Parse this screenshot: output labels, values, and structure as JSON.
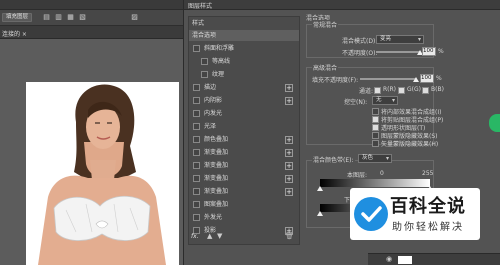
{
  "app": {
    "tab_title": "填充图层",
    "doc_tab": "连接的 ×"
  },
  "dialog": {
    "title": "图层样式",
    "styles_header": "样式",
    "blend_options_item": "混合选项",
    "styles": [
      {
        "label": "斜面和浮雕",
        "checkbox": true,
        "plus": false,
        "indent": 1
      },
      {
        "label": "等高线",
        "checkbox": true,
        "plus": false,
        "indent": 2
      },
      {
        "label": "纹理",
        "checkbox": true,
        "plus": false,
        "indent": 2
      },
      {
        "label": "描边",
        "checkbox": true,
        "plus": true,
        "indent": 1
      },
      {
        "label": "内阴影",
        "checkbox": true,
        "plus": true,
        "indent": 1
      },
      {
        "label": "内发光",
        "checkbox": true,
        "plus": false,
        "indent": 1
      },
      {
        "label": "光泽",
        "checkbox": true,
        "plus": false,
        "indent": 1
      },
      {
        "label": "颜色叠加",
        "checkbox": true,
        "plus": true,
        "indent": 1
      },
      {
        "label": "渐变叠加",
        "checkbox": true,
        "plus": true,
        "indent": 1
      },
      {
        "label": "渐变叠加",
        "checkbox": true,
        "plus": true,
        "indent": 1
      },
      {
        "label": "渐变叠加",
        "checkbox": true,
        "plus": true,
        "indent": 1
      },
      {
        "label": "渐变叠加",
        "checkbox": true,
        "plus": true,
        "indent": 1
      },
      {
        "label": "图案叠加",
        "checkbox": true,
        "plus": false,
        "indent": 1
      },
      {
        "label": "外发光",
        "checkbox": true,
        "plus": false,
        "indent": 1
      },
      {
        "label": "投影",
        "checkbox": true,
        "plus": true,
        "indent": 1
      }
    ],
    "fx_label": "fx.",
    "blend": {
      "section_title": "混合选项",
      "general_title": "常规混合",
      "mode_label": "混合模式(D):",
      "mode_value": "变亮",
      "opacity_label": "不透明度(O):",
      "opacity_value": "100",
      "percent": "%",
      "advanced_title": "高级混合",
      "fill_label": "填充不透明度(F):",
      "fill_value": "100",
      "channels_label": "通道:",
      "channel_r": "R(R)",
      "channel_g": "G(G)",
      "channel_b": "B(B)",
      "knockout_label": "挖空(N):",
      "knockout_value": "无",
      "options": [
        {
          "label": "将内部效果混合成组(I)",
          "checked": false
        },
        {
          "label": "将剪贴图层混合成组(P)",
          "checked": true
        },
        {
          "label": "透明形状图层(T)",
          "checked": true
        },
        {
          "label": "图层蒙版隐藏效果(S)",
          "checked": false
        },
        {
          "label": "矢量蒙版隐藏效果(H)",
          "checked": false
        }
      ],
      "blend_if_label": "混合颜色带(E):",
      "blend_if_value": "灰色",
      "this_layer_label": "本图层:",
      "this_layer_min": "0",
      "this_layer_max": "255",
      "under_layer_label": "下一图层:"
    }
  },
  "watermark": {
    "title": "百科全说",
    "subtitle": "助你轻松解决",
    "brand_color": "#1f8fe0"
  }
}
